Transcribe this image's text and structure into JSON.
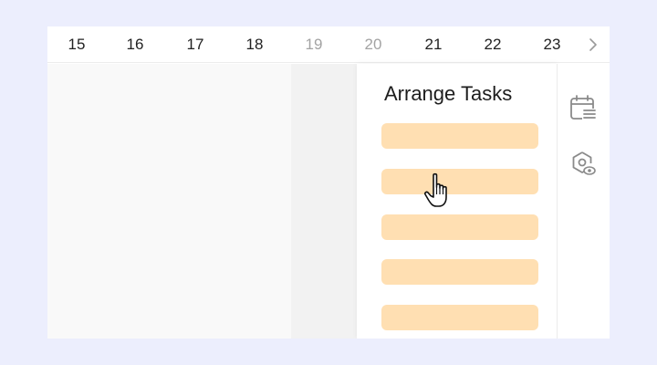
{
  "calendar": {
    "dates": [
      {
        "label": "15",
        "weekend": false
      },
      {
        "label": "16",
        "weekend": false
      },
      {
        "label": "17",
        "weekend": false
      },
      {
        "label": "18",
        "weekend": false
      },
      {
        "label": "19",
        "weekend": true
      },
      {
        "label": "20",
        "weekend": true
      },
      {
        "label": "21",
        "weekend": false
      },
      {
        "label": "22",
        "weekend": false
      },
      {
        "label": "23",
        "weekend": false
      }
    ],
    "next_icon": "chevron-right-icon"
  },
  "panel": {
    "title": "Arrange Tasks",
    "task_count": 5,
    "task_color": "#ffdfb2"
  },
  "sidebar": {
    "icons": [
      "calendar-list-icon",
      "settings-eye-icon"
    ]
  },
  "colors": {
    "background": "#eceefd",
    "weekend_text": "#a3a3a3",
    "icon": "#8a8a8a"
  },
  "cursor": "hand-pointer-icon"
}
